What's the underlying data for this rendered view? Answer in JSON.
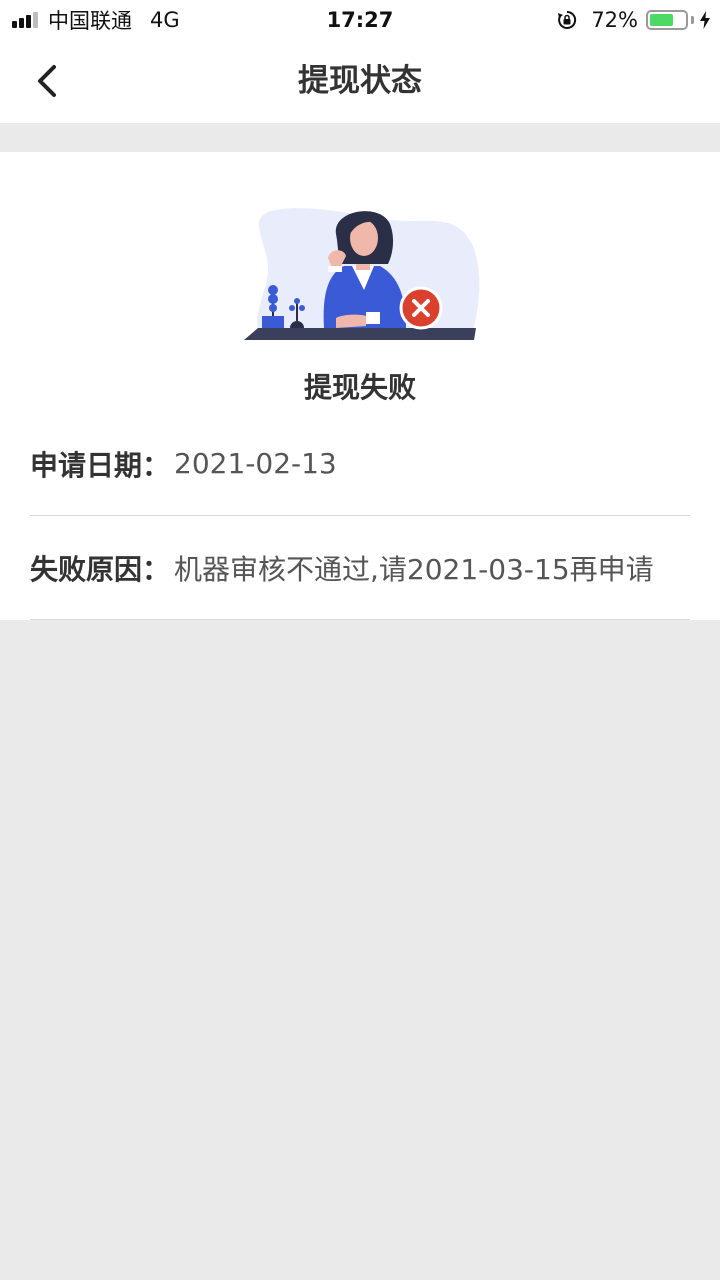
{
  "status_bar": {
    "carrier": "中国联通",
    "network": "4G",
    "time": "17:27",
    "battery_percent": "72%",
    "battery_level": 0.72,
    "battery_color": "#4cd964"
  },
  "nav": {
    "back_icon": "chevron-left-icon",
    "title": "提现状态"
  },
  "result": {
    "illustration": "woman-at-desk-with-error-icon",
    "title": "提现失败",
    "error_color": "#d9412e"
  },
  "details": {
    "date_label": "申请日期：",
    "date_value": "2021-02-13",
    "reason_label": "失败原因：",
    "reason_value": "机器审核不通过,请2021-03-15再申请"
  },
  "colors": {
    "background": "#eaeaea",
    "card": "#ffffff",
    "accent_blue": "#3a5ad6"
  }
}
